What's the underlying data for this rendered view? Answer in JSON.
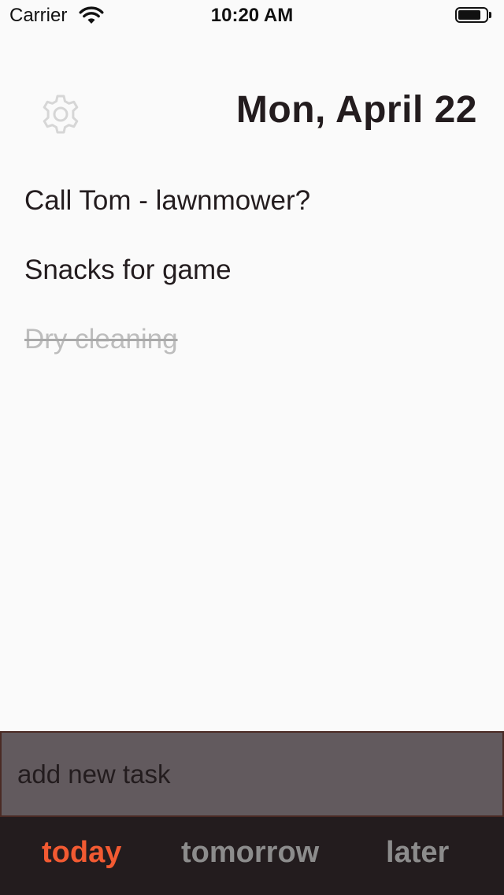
{
  "status_bar": {
    "carrier": "Carrier",
    "time": "10:20 AM",
    "wifi_icon": "wifi-icon",
    "battery_icon": "battery-icon"
  },
  "header": {
    "settings_icon": "gear-icon",
    "date": "Mon, April 22"
  },
  "tasks": [
    {
      "text": "Call Tom - lawnmower?",
      "done": false
    },
    {
      "text": "Snacks for game",
      "done": false
    },
    {
      "text": "Dry cleaning",
      "done": true
    }
  ],
  "add_task": {
    "placeholder": "add new task",
    "value": ""
  },
  "tabs": [
    {
      "label": "today",
      "active": true
    },
    {
      "label": "tomorrow",
      "active": false
    },
    {
      "label": "later",
      "active": false
    }
  ],
  "colors": {
    "background": "#fafafa",
    "text": "#231c1e",
    "done_text": "#bdbdbd",
    "input_bg": "#625a5e",
    "tab_bar_bg": "#231c1e",
    "tab_active": "#f25a32",
    "tab_inactive": "#8c8c8c",
    "icon_gray": "#d6d6d6"
  }
}
